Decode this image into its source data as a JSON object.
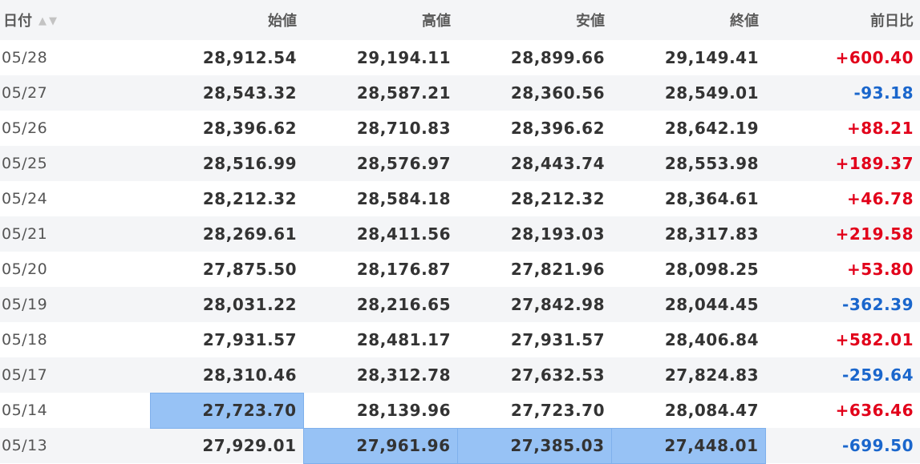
{
  "columns": [
    "日付",
    "始値",
    "高値",
    "安値",
    "終値",
    "前日比"
  ],
  "sort_icons": {
    "asc": "▲",
    "desc": "▼"
  },
  "colors": {
    "up": "#e2001a",
    "down": "#1a66cc",
    "selection": "#97c2f5"
  },
  "rows": [
    [
      "05/28",
      "28,912.54",
      "29,194.11",
      "28,899.66",
      "29,149.41",
      "+600.40"
    ],
    [
      "05/27",
      "28,543.32",
      "28,587.21",
      "28,360.56",
      "28,549.01",
      "-93.18"
    ],
    [
      "05/26",
      "28,396.62",
      "28,710.83",
      "28,396.62",
      "28,642.19",
      "+88.21"
    ],
    [
      "05/25",
      "28,516.99",
      "28,576.97",
      "28,443.74",
      "28,553.98",
      "+189.37"
    ],
    [
      "05/24",
      "28,212.32",
      "28,584.18",
      "28,212.32",
      "28,364.61",
      "+46.78"
    ],
    [
      "05/21",
      "28,269.61",
      "28,411.56",
      "28,193.03",
      "28,317.83",
      "+219.58"
    ],
    [
      "05/20",
      "27,875.50",
      "28,176.87",
      "27,821.96",
      "28,098.25",
      "+53.80"
    ],
    [
      "05/19",
      "28,031.22",
      "28,216.65",
      "27,842.98",
      "28,044.45",
      "-362.39"
    ],
    [
      "05/18",
      "27,931.57",
      "28,481.17",
      "27,931.57",
      "28,406.84",
      "+582.01"
    ],
    [
      "05/17",
      "28,310.46",
      "28,312.78",
      "27,632.53",
      "27,824.83",
      "-259.64"
    ],
    [
      "05/14",
      "27,723.70",
      "28,139.96",
      "27,723.70",
      "28,084.47",
      "+636.46"
    ],
    [
      "05/13",
      "27,929.01",
      "27,961.96",
      "27,385.03",
      "27,448.01",
      "-699.50"
    ]
  ],
  "selected_cells": [
    [
      10,
      1
    ],
    [
      11,
      2
    ],
    [
      11,
      3
    ],
    [
      11,
      4
    ]
  ]
}
